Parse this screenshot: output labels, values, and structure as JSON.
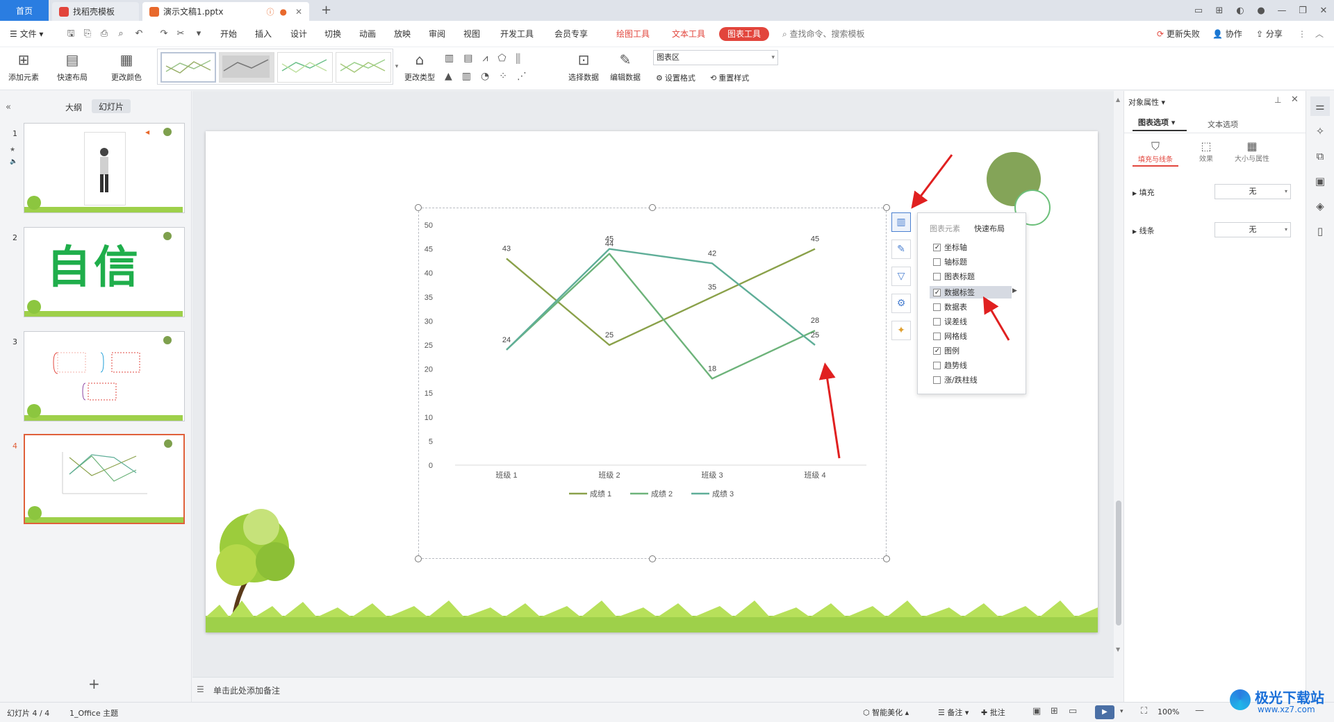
{
  "tabs": {
    "home": "首页",
    "template": "找稻壳模板",
    "doc": "演示文稿1.pptx"
  },
  "menu": {
    "file": "文件",
    "items": [
      "开始",
      "插入",
      "设计",
      "切换",
      "动画",
      "放映",
      "审阅",
      "视图",
      "开发工具",
      "会员专享"
    ],
    "context": [
      "绘图工具",
      "文本工具"
    ],
    "active": "图表工具",
    "search": "查找命令、搜索模板",
    "right": [
      "更新失败",
      "协作",
      "分享"
    ]
  },
  "ribbon": {
    "add_element": "添加元素",
    "quick_layout": "快速布局",
    "change_color": "更改颜色",
    "change_type": "更改类型",
    "select_data": "选择数据",
    "edit_data": "编辑数据",
    "chart_area": "图表区",
    "set_format": "设置格式",
    "reset_style": "重置样式"
  },
  "left_panel": {
    "outline": "大纲",
    "slides": "幻灯片",
    "numbers": [
      "1",
      "2",
      "3",
      "4"
    ],
    "slide2_text": "自信"
  },
  "notes": {
    "placeholder": "单击此处添加备注"
  },
  "chart_data": {
    "type": "line",
    "categories": [
      "班级 1",
      "班级 2",
      "班级 3",
      "班级 4"
    ],
    "series": [
      {
        "name": "成绩 1",
        "values": [
          43,
          25,
          35,
          45
        ],
        "color": "#8aa14a"
      },
      {
        "name": "成绩 2",
        "values": [
          24,
          44,
          18,
          28
        ],
        "color": "#6db37a"
      },
      {
        "name": "成绩 3",
        "values": [
          24,
          45,
          42,
          25
        ],
        "color": "#5fae98"
      }
    ],
    "yticks": [
      "0",
      "5",
      "10",
      "15",
      "20",
      "25",
      "30",
      "35",
      "40",
      "45",
      "50"
    ],
    "ylim": [
      0,
      50
    ],
    "labels": [
      {
        "text": "43",
        "s": 0,
        "i": 0
      },
      {
        "text": "25",
        "s": 0,
        "i": 1
      },
      {
        "text": "35",
        "s": 0,
        "i": 2
      },
      {
        "text": "45",
        "s": 0,
        "i": 3
      },
      {
        "text": "24",
        "s": 1,
        "i": 0
      },
      {
        "text": "44",
        "s": 1,
        "i": 1
      },
      {
        "text": "18",
        "s": 1,
        "i": 2
      },
      {
        "text": "28",
        "s": 1,
        "i": 3
      },
      {
        "text": "45",
        "s": 2,
        "i": 1
      },
      {
        "text": "42",
        "s": 2,
        "i": 2
      },
      {
        "text": "25",
        "s": 2,
        "i": 3
      }
    ],
    "legend_position": "bottom"
  },
  "popup": {
    "tab1": "图表元素",
    "tab2": "快速布局",
    "items": [
      {
        "label": "坐标轴",
        "checked": true
      },
      {
        "label": "轴标题",
        "checked": false
      },
      {
        "label": "图表标题",
        "checked": false
      },
      {
        "label": "数据标签",
        "checked": true
      },
      {
        "label": "数据表",
        "checked": false
      },
      {
        "label": "误差线",
        "checked": false
      },
      {
        "label": "网格线",
        "checked": false
      },
      {
        "label": "图例",
        "checked": true
      },
      {
        "label": "趋势线",
        "checked": false
      },
      {
        "label": "涨/跌柱线",
        "checked": false
      }
    ]
  },
  "right_panel": {
    "title": "对象属性",
    "tab_chart": "图表选项",
    "tab_text": "文本选项",
    "sub": [
      "填充与线条",
      "效果",
      "大小与属性"
    ],
    "fill_label": "填充",
    "fill_value": "无",
    "line_label": "线条",
    "line_value": "无"
  },
  "status": {
    "slide": "幻灯片 4 / 4",
    "theme": "1_Office 主题",
    "beautify": "智能美化",
    "notes": "备注",
    "comment": "批注",
    "zoom": "100%"
  },
  "watermark": "极光下载站",
  "watermark_url": "www.xz7.com"
}
